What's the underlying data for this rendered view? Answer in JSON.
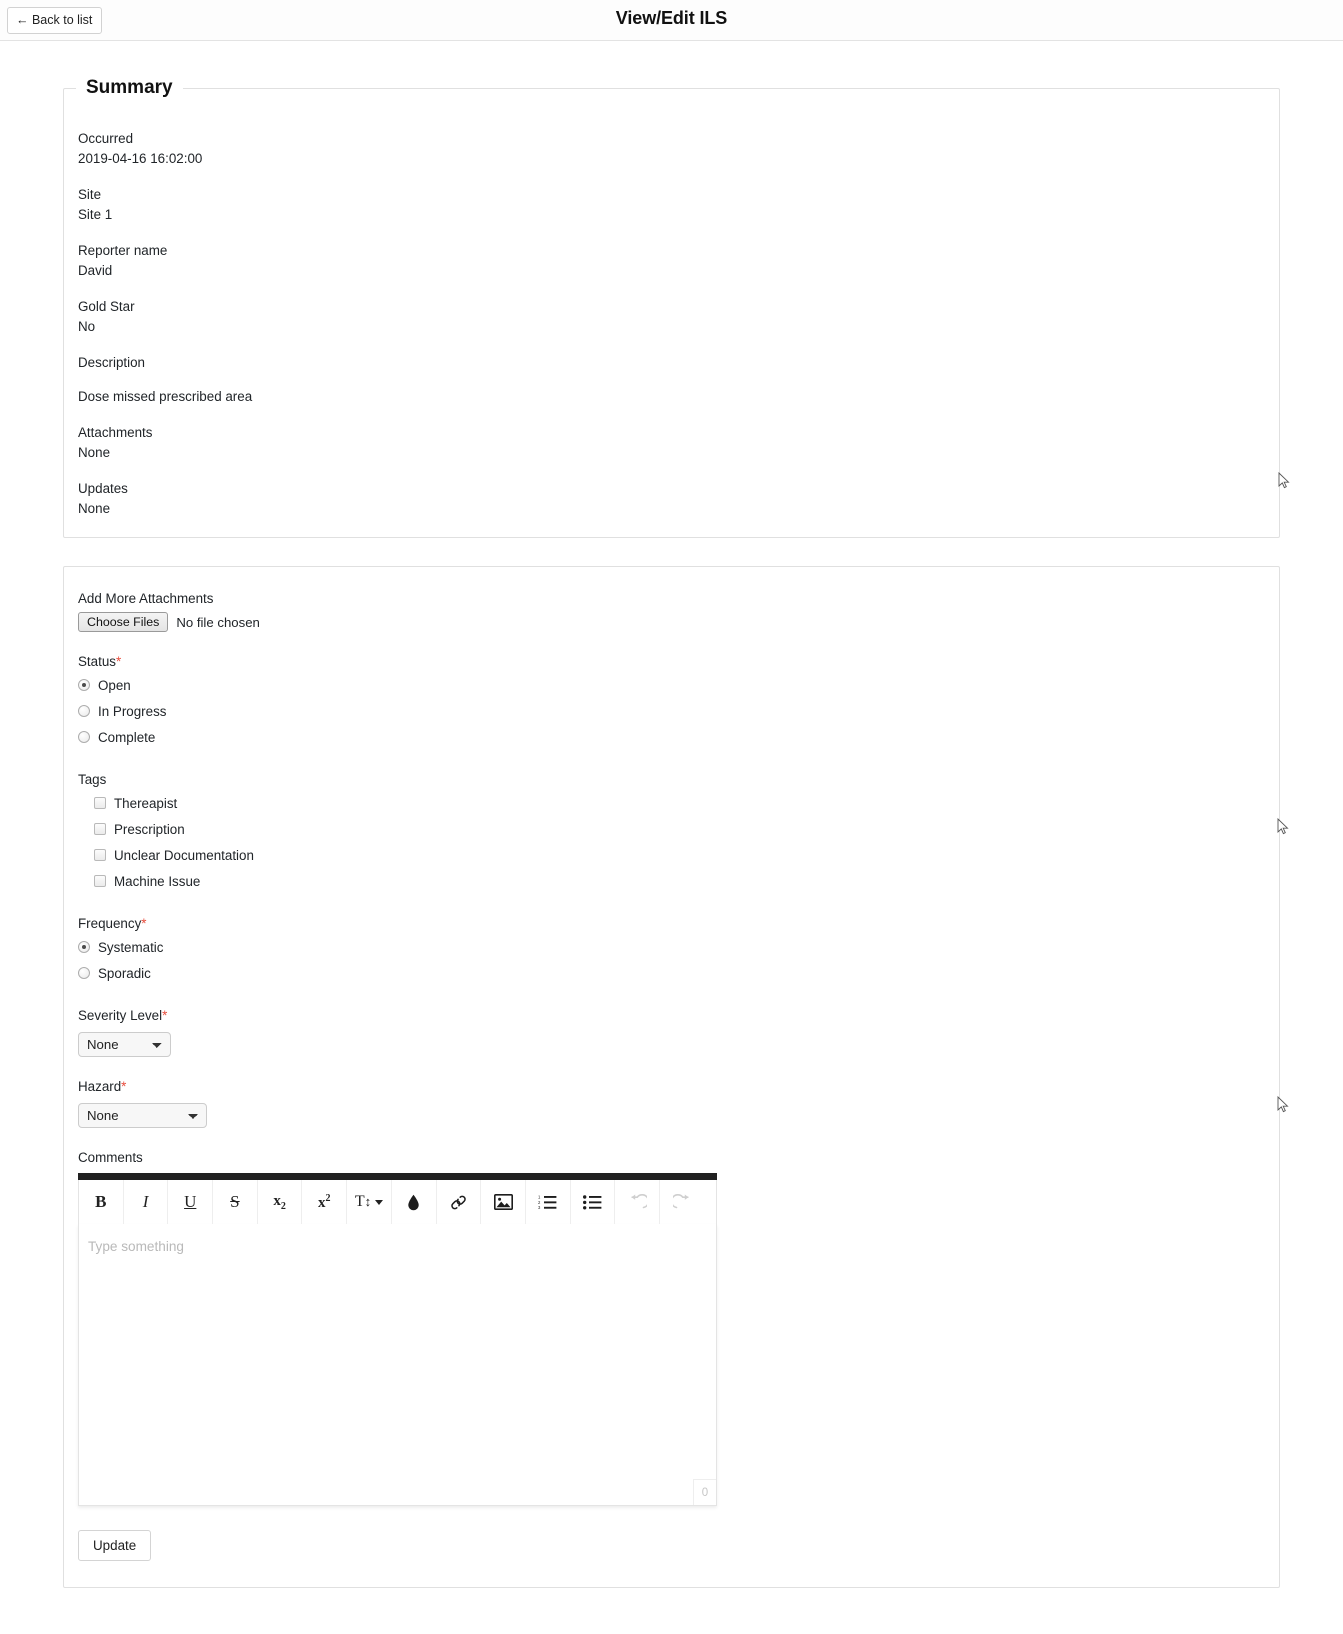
{
  "header": {
    "back_label": "← Back to list",
    "title": "View/Edit ILS"
  },
  "summary": {
    "legend": "Summary",
    "fields": [
      {
        "label": "Occurred",
        "value": "2019-04-16 16:02:00"
      },
      {
        "label": "Site",
        "value": "Site 1"
      },
      {
        "label": "Reporter name",
        "value": "David"
      },
      {
        "label": "Gold Star",
        "value": "No"
      },
      {
        "label": "Description",
        "value": "Dose missed prescribed area"
      },
      {
        "label": "Attachments",
        "value": "None"
      },
      {
        "label": "Updates",
        "value": "None"
      }
    ]
  },
  "form": {
    "attachments": {
      "label": "Add More Attachments",
      "button_label": "Choose Files",
      "status_text": "No file chosen"
    },
    "status": {
      "label": "Status",
      "required_marker": "*",
      "options": [
        {
          "label": "Open",
          "checked": true
        },
        {
          "label": "In Progress",
          "checked": false
        },
        {
          "label": "Complete",
          "checked": false
        }
      ]
    },
    "tags": {
      "label": "Tags",
      "options": [
        {
          "label": "Thereapist",
          "checked": false
        },
        {
          "label": "Prescription",
          "checked": false
        },
        {
          "label": "Unclear Documentation",
          "checked": false
        },
        {
          "label": "Machine Issue",
          "checked": false
        }
      ]
    },
    "frequency": {
      "label": "Frequency",
      "required_marker": "*",
      "options": [
        {
          "label": "Systematic",
          "checked": true
        },
        {
          "label": "Sporadic",
          "checked": false
        }
      ]
    },
    "severity": {
      "label": "Severity Level",
      "required_marker": "*",
      "value": "None",
      "options": [
        "None"
      ]
    },
    "hazard": {
      "label": "Hazard",
      "required_marker": "*",
      "value": "None",
      "options": [
        "None"
      ]
    },
    "comments": {
      "label": "Comments",
      "placeholder": "Type something",
      "char_count": "0",
      "toolbar": [
        {
          "name": "bold-icon",
          "glyph": "B",
          "disabled": false
        },
        {
          "name": "italic-icon",
          "glyph": "I",
          "disabled": false
        },
        {
          "name": "underline-icon",
          "glyph": "U",
          "disabled": false
        },
        {
          "name": "strikethrough-icon",
          "glyph": "S",
          "disabled": false
        },
        {
          "name": "subscript-icon",
          "glyph": "x2",
          "disabled": false
        },
        {
          "name": "superscript-icon",
          "glyph": "x2sup",
          "disabled": false
        },
        {
          "name": "font-size-icon",
          "glyph": "T↕",
          "disabled": false
        },
        {
          "name": "text-color-icon",
          "glyph": "drop",
          "disabled": false
        },
        {
          "name": "link-icon",
          "glyph": "link",
          "disabled": false
        },
        {
          "name": "image-icon",
          "glyph": "image",
          "disabled": false
        },
        {
          "name": "ordered-list-icon",
          "glyph": "ol",
          "disabled": false
        },
        {
          "name": "unordered-list-icon",
          "glyph": "ul",
          "disabled": false
        },
        {
          "name": "undo-icon",
          "glyph": "undo",
          "disabled": true
        },
        {
          "name": "redo-icon",
          "glyph": "redo",
          "disabled": true
        }
      ]
    },
    "update_label": "Update"
  },
  "colors": {
    "required": "#e74c3c",
    "editor_topbar": "#212121",
    "border": "#e0e0e0"
  }
}
